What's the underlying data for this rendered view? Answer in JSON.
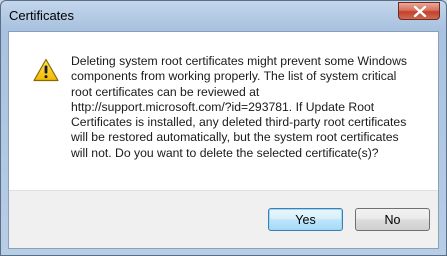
{
  "dialog": {
    "title": "Certificates",
    "close_icon": "close-icon",
    "warning_icon": "warning-triangle-icon",
    "message": "Deleting system root certificates might prevent some Windows\ncomponents from working properly. The list of system critical\nroot certificates can be reviewed at\nhttp://support.microsoft.com/?id=293781. If Update Root\nCertificates is installed, any deleted third-party root certificates\nwill be restored automatically, but the system root certificates\nwill not. Do you want to delete the selected certificate(s)?",
    "buttons": {
      "yes_label": "Yes",
      "no_label": "No"
    },
    "colors": {
      "close_button": "#c2412b",
      "warning_fill": "#f5c400",
      "default_button_border": "#3c7fb1"
    }
  }
}
